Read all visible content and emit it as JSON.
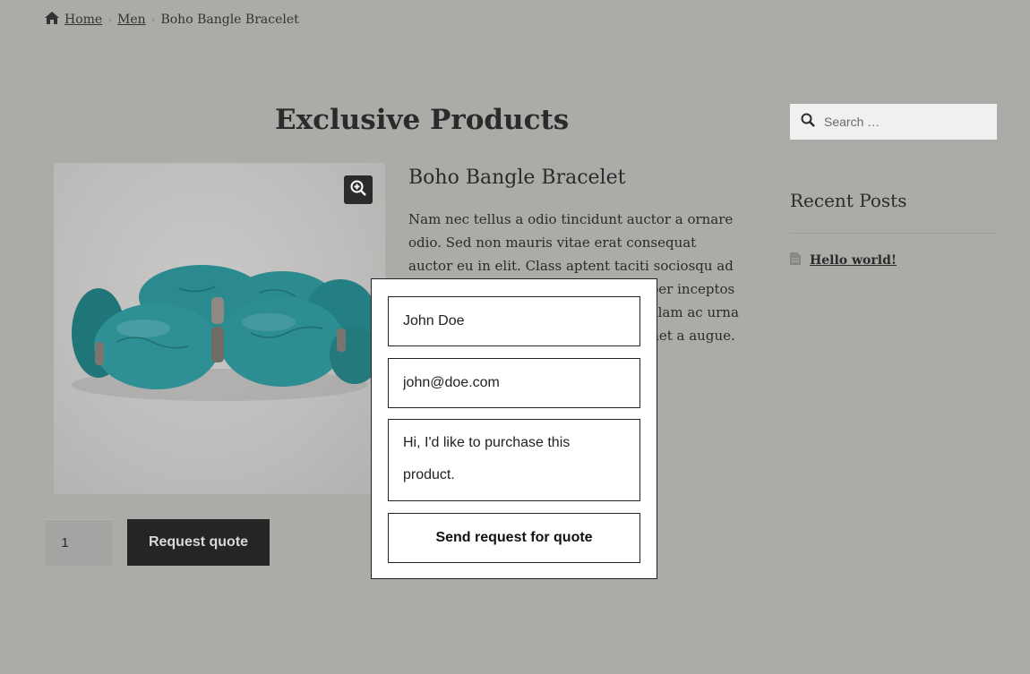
{
  "breadcrumb": {
    "home": "Home",
    "category": "Men",
    "current": "Boho Bangle Bracelet"
  },
  "page": {
    "title": "Exclusive Products"
  },
  "product": {
    "title": "Boho Bangle Bracelet",
    "description": "Nam nec tellus a odio tincidunt auctor a ornare odio. Sed non mauris vitae erat consequat auctor eu in elit. Class aptent taciti sociosqu ad litora torquent per conubia nostra, per inceptos himenaeos. Mauris in erat justo. Nullam ac urna eu felis dapibus condimentum sit amet a augue. Sed non neque elit",
    "quantity": "1",
    "request_quote_label": "Request quote"
  },
  "sidebar": {
    "search_placeholder": "Search …",
    "recent_posts_title": "Recent Posts",
    "posts": [
      "Hello world!"
    ]
  },
  "quote_form": {
    "name_value": "John Doe",
    "email_value": "john@doe.com",
    "message_value": "Hi, I'd like to purchase this product.",
    "submit_label": "Send request for quote"
  },
  "icons": {
    "home": "home-icon",
    "zoom": "zoom-in-icon",
    "search": "search-icon",
    "post": "document-icon"
  },
  "colors": {
    "overlay_bg": "#adaba8",
    "button_dark": "#252525",
    "bead": "#2a8a8e"
  }
}
